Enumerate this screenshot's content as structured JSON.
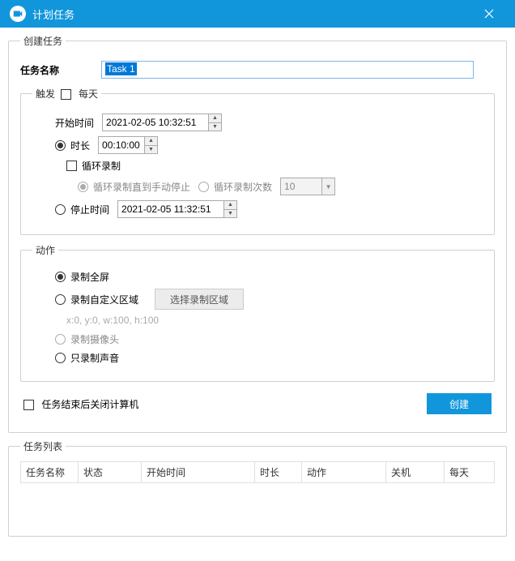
{
  "window": {
    "title": "计划任务"
  },
  "createTask": {
    "legend": "创建任务",
    "nameLabel": "任务名称",
    "nameValue": "Task 1"
  },
  "trigger": {
    "legend": "触发",
    "daily": "每天",
    "startTimeLabel": "开始时间",
    "startTimeValue": "2021-02-05 10:32:51",
    "durationLabel": "时长",
    "durationValue": "00:10:00",
    "loopRecord": "循环录制",
    "loopUntilStop": "循环录制直到手动停止",
    "loopCount": "循环录制次数",
    "loopCountValue": "10",
    "stopTimeLabel": "停止时间",
    "stopTimeValue": "2021-02-05 11:32:51"
  },
  "action": {
    "legend": "动作",
    "fullscreen": "录制全屏",
    "customArea": "录制自定义区域",
    "selectAreaBtn": "选择录制区域",
    "coords": "x:0, y:0, w:100, h:100",
    "camera": "录制摄像头",
    "audioOnly": "只录制声音"
  },
  "footer": {
    "shutdown": "任务结束后关闭计算机",
    "createBtn": "创建"
  },
  "taskList": {
    "legend": "任务列表",
    "columns": [
      "任务名称",
      "状态",
      "开始时间",
      "时长",
      "动作",
      "关机",
      "每天"
    ]
  }
}
